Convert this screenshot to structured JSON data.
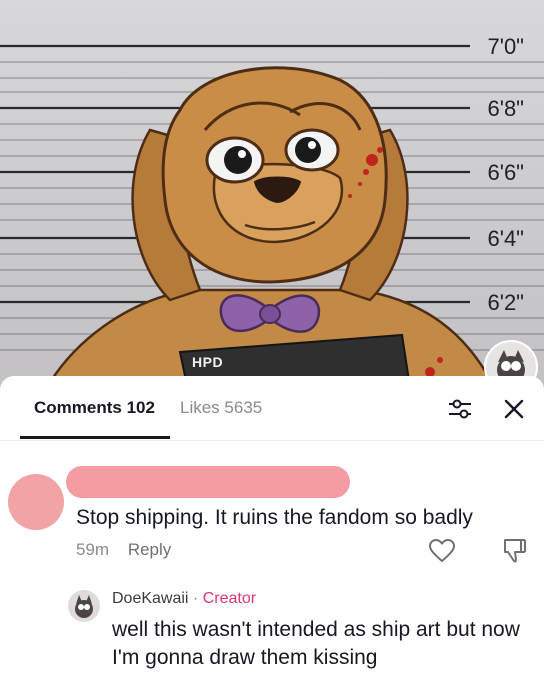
{
  "artwork": {
    "height_marks": [
      "7'0\"",
      "6'8\"",
      "6'6\"",
      "6'4\"",
      "6'2\""
    ],
    "sign_text": "HPD"
  },
  "comments_panel": {
    "tab_comments": "Comments 102",
    "tab_likes": "Likes 5635",
    "icons": {
      "filter": "sliders-icon",
      "close": "close-icon"
    }
  },
  "comment": {
    "text": "Stop shipping. It ruins the fandom so badly",
    "time": "59m",
    "reply_label": "Reply",
    "icons": {
      "like": "heart-icon",
      "dislike": "dislike-icon"
    },
    "redaction_color": "#f59ca3"
  },
  "reply": {
    "author": "DoeKawaii",
    "separator": " · ",
    "badge": "Creator",
    "text": "well this wasn't intended as ship art but now I'm gonna draw them kissing",
    "badge_color": "#e0376a"
  }
}
